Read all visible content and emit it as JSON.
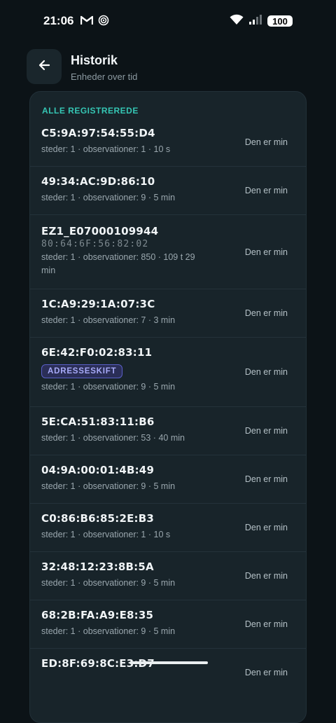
{
  "status": {
    "time": "21:06",
    "battery": "100"
  },
  "header": {
    "title": "Historik",
    "subtitle": "Enheder over tid"
  },
  "section": {
    "label": "ALLE REGISTREREDE"
  },
  "devices": [
    {
      "name": "C5:9A:97:54:55:D4",
      "sub": "steder: 1 · observationer: 1 · 10 s",
      "action": "Den er min"
    },
    {
      "name": "49:34:AC:9D:86:10",
      "sub": "steder: 1 · observationer: 9 · 5 min",
      "action": "Den er min"
    },
    {
      "name": "EZ1_E07000109944",
      "mac": "80:64:6F:56:82:02",
      "sub": "steder: 1 · observationer: 850 · 109 t 29 min",
      "action": "Den er min"
    },
    {
      "name": "1C:A9:29:1A:07:3C",
      "sub": "steder: 1 · observationer: 7 · 3 min",
      "action": "Den er min"
    },
    {
      "name": "6E:42:F0:02:83:11",
      "badge": "ADRESSESKIFT",
      "sub": "steder: 1 · observationer: 9 · 5 min",
      "action": "Den er min"
    },
    {
      "name": "5E:CA:51:83:11:B6",
      "sub": "steder: 1 · observationer: 53 · 40 min",
      "action": "Den er min"
    },
    {
      "name": "04:9A:00:01:4B:49",
      "sub": "steder: 1 · observationer: 9 · 5 min",
      "action": "Den er min"
    },
    {
      "name": "C0:86:B6:85:2E:B3",
      "sub": "steder: 1 · observationer: 1 · 10 s",
      "action": "Den er min"
    },
    {
      "name": "32:48:12:23:8B:5A",
      "sub": "steder: 1 · observationer: 9 · 5 min",
      "action": "Den er min"
    },
    {
      "name": "68:2B:FA:A9:E8:35",
      "sub": "steder: 1 · observationer: 9 · 5 min",
      "action": "Den er min"
    },
    {
      "name": "ED:8F:69:8C:E3:D7",
      "sub": "",
      "action": "Den er min"
    }
  ]
}
